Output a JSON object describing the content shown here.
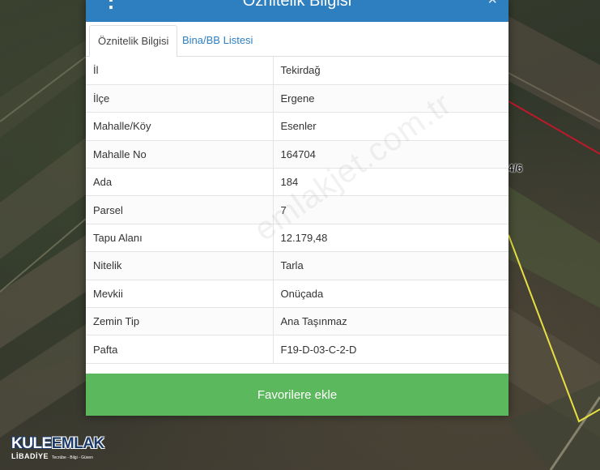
{
  "map": {
    "parcel_label": "4/6"
  },
  "logo": {
    "brand_part1": "KULE",
    "brand_part2": "EMLAK",
    "city": "LİBADİYE",
    "tagline": "Tecrübe - Bilgi - Güven"
  },
  "modal": {
    "title": "Öznitelik Bilgisi",
    "close_symbol": "×",
    "menu_symbol": "⋮",
    "tabs": [
      {
        "label": "Öznitelik Bilgisi",
        "active": true
      },
      {
        "label": "Bina/BB Listesi",
        "active": false
      }
    ],
    "rows": [
      {
        "key": "İl",
        "value": "Tekirdağ"
      },
      {
        "key": "İlçe",
        "value": "Ergene"
      },
      {
        "key": "Mahalle/Köy",
        "value": "Esenler"
      },
      {
        "key": "Mahalle No",
        "value": "164704"
      },
      {
        "key": "Ada",
        "value": "184"
      },
      {
        "key": "Parsel",
        "value": "7"
      },
      {
        "key": "Tapu Alanı",
        "value": "12.179,48"
      },
      {
        "key": "Nitelik",
        "value": "Tarla"
      },
      {
        "key": "Mevkii",
        "value": "Onüçada"
      },
      {
        "key": "Zemin Tip",
        "value": "Ana Taşınmaz"
      },
      {
        "key": "Pafta",
        "value": "F19-D-03-C-2-D"
      }
    ],
    "favorite_button": "Favorilere ekle",
    "watermark": "emlakjet.com.tr"
  },
  "colors": {
    "header": "#2e7fc0",
    "tab_link": "#2e7fc0",
    "favorite_button": "#5cb85c",
    "parcel_border_red": "#c0182a",
    "parcel_border_yellow": "#e8e040"
  }
}
